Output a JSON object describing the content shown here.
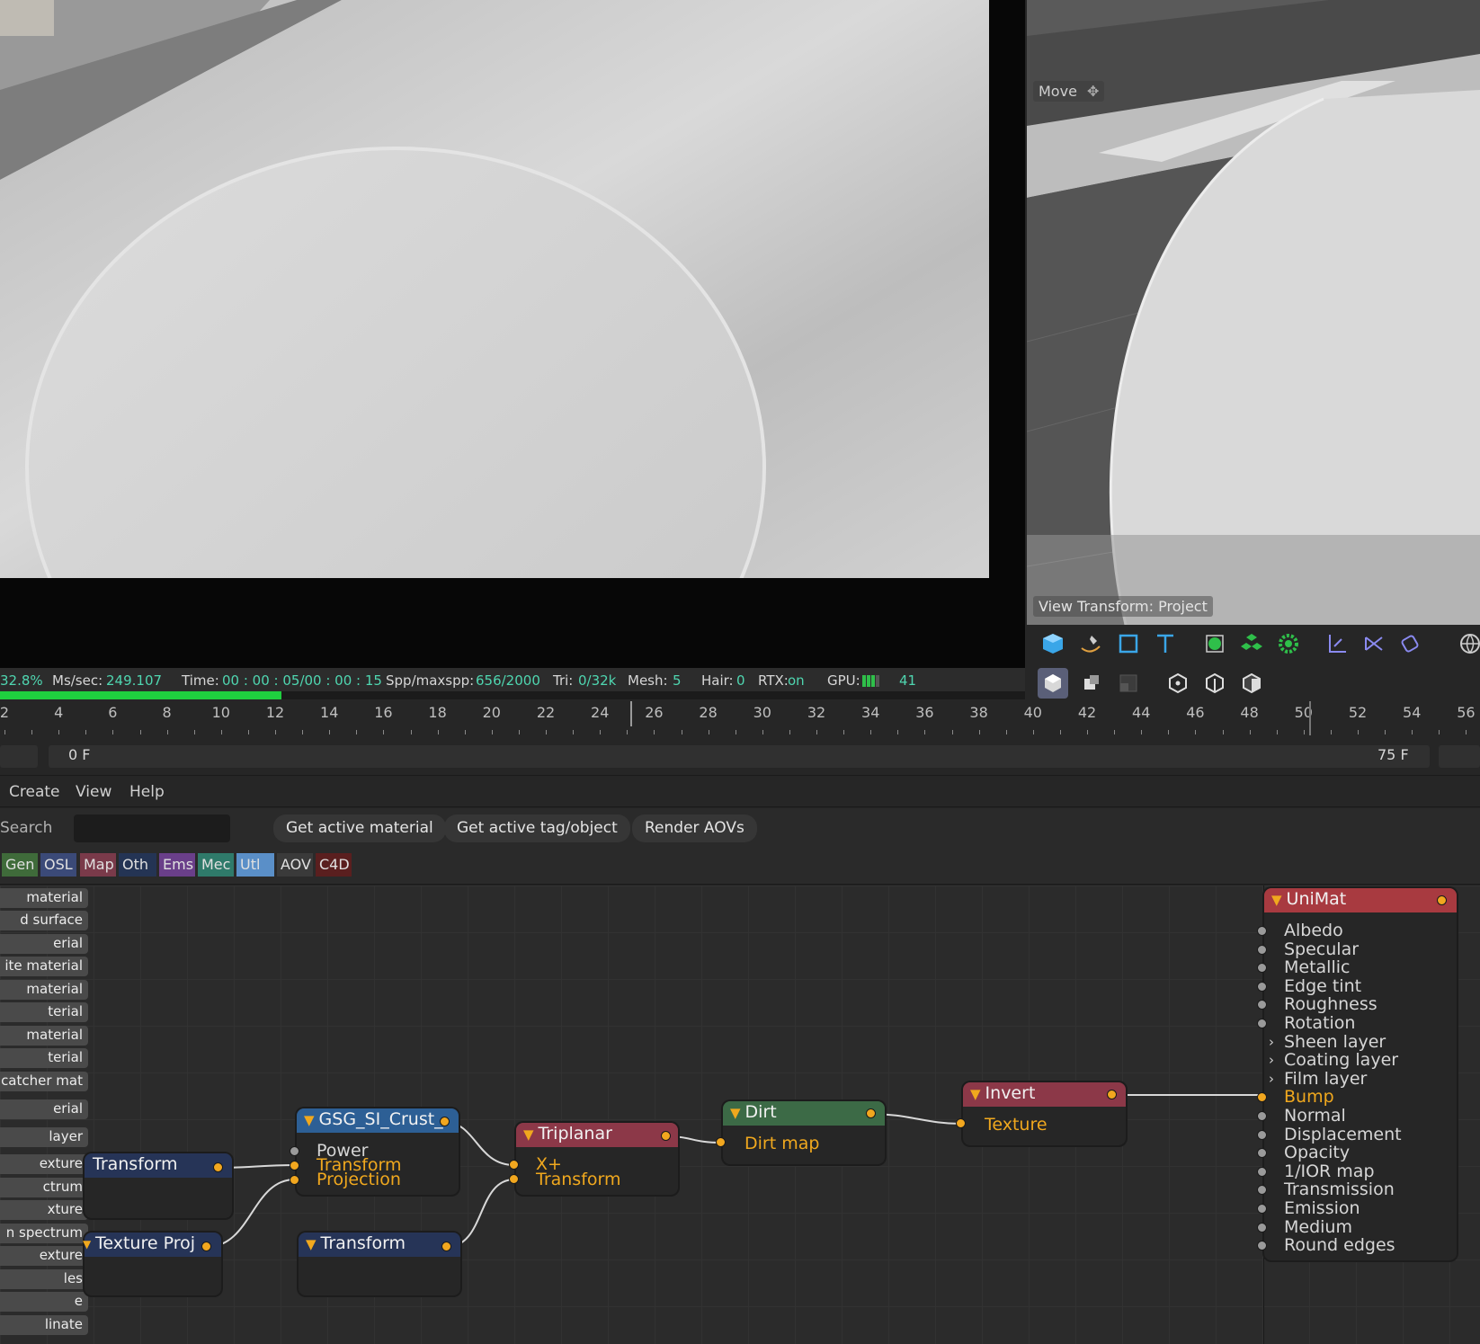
{
  "statusbar": {
    "percent": "32.8%",
    "ms_label": "Ms/sec:",
    "ms_value": "249.107",
    "time_label": "Time:",
    "time_value": "00 : 00 : 05/00 : 00 : 15",
    "spp_label": "Spp/maxspp:",
    "spp_value": "656/2000",
    "tri_label": "Tri:",
    "tri_value": "0/32k",
    "mesh_label": "Mesh:",
    "mesh_value": "5",
    "hair_label": "Hair:",
    "hair_value": "0",
    "rtx_label": "RTX:",
    "rtx_value": "on",
    "gpu_label": "GPU:",
    "gpu_value": "41",
    "progress": 0.328
  },
  "viewport": {
    "move_label": "Move",
    "view_transform_label": "View Transform: Project"
  },
  "timeline": {
    "ticks": [
      "2",
      "4",
      "6",
      "8",
      "10",
      "12",
      "14",
      "16",
      "18",
      "20",
      "22",
      "24",
      "26",
      "28",
      "30",
      "32",
      "34",
      "36",
      "38",
      "40",
      "42",
      "44",
      "46",
      "48",
      "50",
      "52",
      "54",
      "56"
    ],
    "start_frame": "0 F",
    "end_frame": "75 F"
  },
  "menu": {
    "create": "Create",
    "view": "View",
    "help": "Help"
  },
  "search": {
    "label": "Search",
    "placeholder": ""
  },
  "buttons": {
    "get_active_material": "Get active material",
    "get_active_tag": "Get active tag/object",
    "render_aovs": "Render AOVs"
  },
  "categories": [
    {
      "label": "Gen",
      "color": "#3f6b3a"
    },
    {
      "label": "OSL",
      "color": "#3b4a78"
    },
    {
      "label": "Map",
      "color": "#7a3a4a"
    },
    {
      "label": "Oth",
      "color": "#243454"
    },
    {
      "label": "Ems",
      "color": "#6a3f8a"
    },
    {
      "label": "Mec",
      "color": "#2f7a6a"
    },
    {
      "label": "Utl",
      "color": "#5a8fc8"
    },
    {
      "label": "AOV",
      "color": "#3a3a3a"
    },
    {
      "label": "C4D",
      "color": "#5a1f1f"
    }
  ],
  "library": [
    "material",
    "d surface",
    "erial",
    "ite material",
    " material",
    "terial",
    " material",
    "terial",
    " catcher mat",
    "erial",
    " layer",
    "exture",
    "ctrum",
    "xture",
    "n spectrum",
    "exture",
    "les",
    "e",
    "linate"
  ],
  "nodes": {
    "transform1": {
      "title": "Transform",
      "color": "#263457"
    },
    "texture_proj": {
      "title": "Texture Proj",
      "color": "#263457"
    },
    "gsg": {
      "title": "GSG_SI_Crust_",
      "color": "#2d5f95",
      "in_power": "Power",
      "in_transform": "Transform",
      "in_projection": "Projection"
    },
    "transform2": {
      "title": "Transform",
      "color": "#263457"
    },
    "triplanar": {
      "title": "Triplanar",
      "color": "#8c3848",
      "in_x": "X+",
      "in_transform": "Transform"
    },
    "dirt": {
      "title": "Dirt",
      "color": "#3c6a46",
      "in_dirt": "Dirt map"
    },
    "invert": {
      "title": "Invert",
      "color": "#8c3848",
      "in_texture": "Texture"
    },
    "unimat": {
      "title": "UniMat",
      "color": "#a83a40",
      "inputs": [
        "Albedo",
        "Specular",
        "Metallic",
        "Edge tint",
        "Roughness",
        "Rotation",
        "Sheen layer",
        "Coating layer",
        "Film layer",
        "Bump",
        "Normal",
        "Displacement",
        "Opacity",
        "1/IOR map",
        "Transmission",
        "Emission",
        "Medium",
        "Round edges"
      ],
      "active_input": "Bump",
      "text_color": "#d6d6d6",
      "active_color": "#f0a81e"
    }
  },
  "colors": {
    "accent_orange": "#f0a81e",
    "status_value": "#4fd6b0",
    "progress_green": "#1fcf3f"
  }
}
